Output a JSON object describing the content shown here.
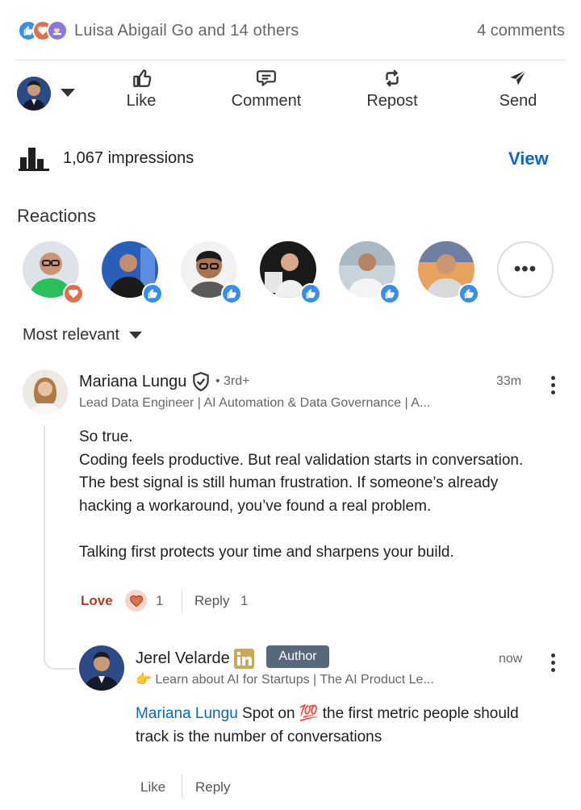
{
  "summary": {
    "reacted_by": "Luisa Abigail Go and 14 others",
    "comments": "4 comments",
    "reaction_icons": [
      "like-icon",
      "love-icon",
      "support-icon"
    ]
  },
  "actions": {
    "like": "Like",
    "comment": "Comment",
    "repost": "Repost",
    "send": "Send"
  },
  "impressions": {
    "count_text": "1,067 impressions",
    "view_label": "View"
  },
  "reactions": {
    "heading": "Reactions",
    "people": [
      {
        "badge": "love"
      },
      {
        "badge": "like"
      },
      {
        "badge": "like"
      },
      {
        "badge": "like"
      },
      {
        "badge": "like"
      },
      {
        "badge": "like"
      }
    ],
    "more": "•••"
  },
  "sort": {
    "label": "Most relevant"
  },
  "comment1": {
    "name": "Mariana Lungu",
    "degree": "• 3rd+",
    "headline": "Lead Data Engineer | AI Automation & Data Governance | A...",
    "time": "33m",
    "body_lines": [
      "So true.",
      "Coding feels productive. But real validation starts in conversation.",
      "The best signal is still human frustration. If someone’s already",
      "hacking a workaround, you’ve found a real problem.",
      "",
      "Talking first protects your time and sharpens your build."
    ],
    "love_label": "Love",
    "love_count": "1",
    "reply_label": "Reply",
    "reply_count": "1"
  },
  "reply1": {
    "name": "Jerel Velarde",
    "author_badge": "Author",
    "headline": "👉 Learn about AI for Startups | The AI Product Le...",
    "time": "now",
    "mention": "Mariana Lungu",
    "text_before_emoji": " Spot on ",
    "emoji": "💯",
    "text_after_emoji": "  the first metric people should",
    "line2": "track is the number of conversations",
    "like_label": "Like",
    "reply_label": "Reply"
  },
  "colors": {
    "accent": "#0a66c2",
    "love": "#b24020",
    "like_badge": "#378fe9",
    "author_badge": "#56687a"
  }
}
